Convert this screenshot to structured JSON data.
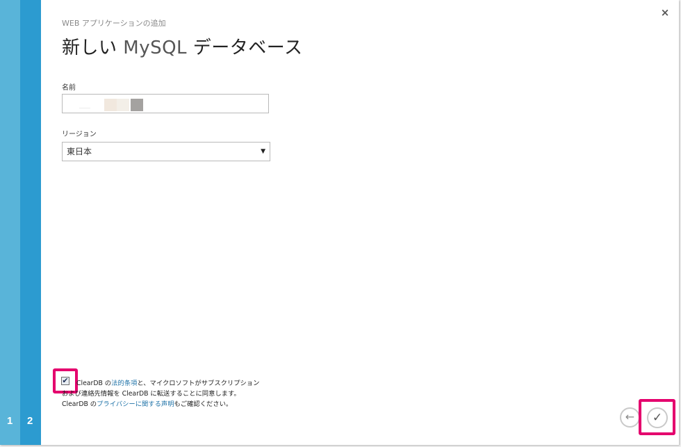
{
  "steps": [
    "1",
    "2"
  ],
  "header": {
    "subtitle": "WEB アプリケーションの追加",
    "title_part1": "新しい ",
    "title_part2": "MySQL",
    "title_part3": " データベース"
  },
  "close_icon": "×",
  "form": {
    "name_label": "名前",
    "name_value": "",
    "region_label": "リージョン",
    "region_value": "東日本",
    "region_arrow": "▼"
  },
  "terms": {
    "checked": true,
    "check_mark": "✔",
    "t1": "ClearDB の",
    "link1": "法的条項",
    "t2": "と、マイクロソフトがサブスクリプション",
    "t3": "および連絡先情報を ClearDB に転送することに同意します。",
    "t4": "ClearDB の",
    "link2": "プライバシーに関する声明",
    "t5": "もご確認ください。"
  },
  "nav": {
    "back_icon": "←",
    "confirm_icon": "✓"
  },
  "colors": {
    "rail_light": "#59b4d9",
    "rail_dark": "#2c9bd0",
    "highlight": "#e4006d",
    "link": "#1f73a8"
  }
}
